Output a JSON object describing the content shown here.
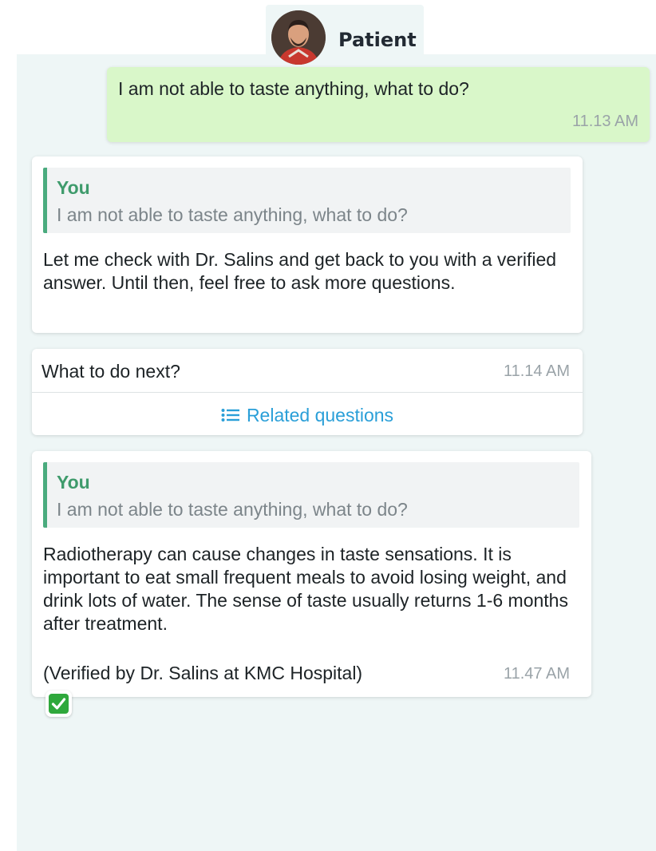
{
  "header": {
    "title": "Patient"
  },
  "messages": {
    "outgoing": {
      "text": "I am not able to taste anything, what to do?",
      "time": "11.13 AM"
    },
    "reply1": {
      "quote_author": "You",
      "quote_text": "I am not able to taste anything, what to do?",
      "text": "Let me check with Dr. Salins and get back to you with a verified answer. Until then, feel free to ask more questions."
    },
    "next_card": {
      "text": "What to do next?",
      "time": "11.14 AM",
      "related_label": "Related questions"
    },
    "reply2": {
      "quote_author": "You",
      "quote_text": "I am not able to taste anything, what to do?",
      "text": "Radiotherapy can cause changes in taste sensations. It is important to eat small frequent meals to avoid losing weight, and drink lots of water. The sense of taste usually returns 1-6 months after treatment.",
      "verified_text": "(Verified by Dr. Salins at KMC Hospital)",
      "time": "11.47 AM"
    }
  },
  "icons": {
    "related": "list-icon",
    "verified": "check-mark-icon"
  },
  "colors": {
    "chat_background": "#eef6f6",
    "outgoing_bubble": "#d9f7c9",
    "quote_accent": "#4aab7e",
    "link": "#2a9fd8",
    "verified_green": "#2fa83c"
  }
}
